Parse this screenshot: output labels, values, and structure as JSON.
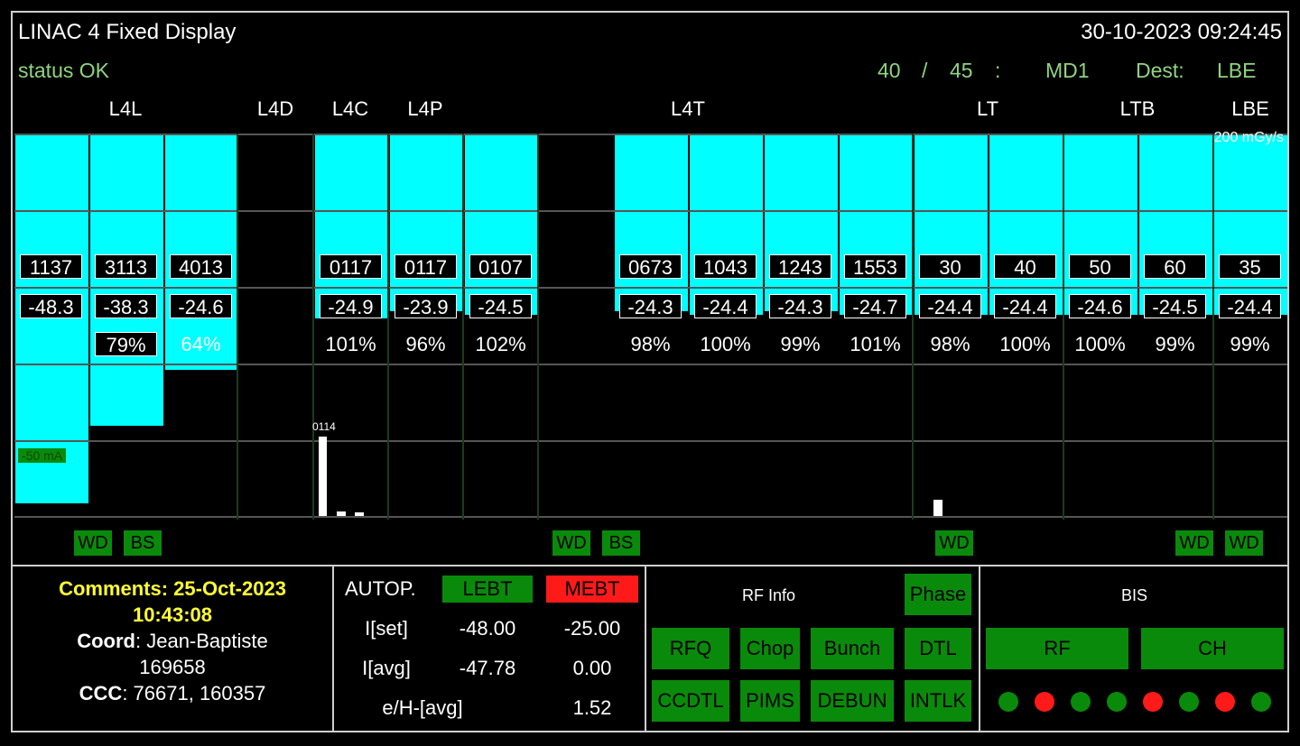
{
  "header": {
    "title": "LINAC 4 Fixed Display",
    "datetime": "30-10-2023 09:24:45",
    "status": "status OK",
    "cycle_current": "40",
    "cycle_sep": "/",
    "cycle_total": "45",
    "colon": ":",
    "user": "MD1",
    "dest_label": "Dest:",
    "dest_value": "LBE"
  },
  "sections": [
    "L4L",
    "L4D",
    "L4C",
    "L4P",
    "L4T",
    "LT",
    "LTB",
    "LBE"
  ],
  "scale_top": "200 mGy/s",
  "scale_left": "-50 mA",
  "spike_label": "0114",
  "columns": [
    {
      "val1": "1137",
      "val2": "-48.3",
      "pct": "",
      "fill": 1.0,
      "pct_boxed": false
    },
    {
      "val1": "3113",
      "val2": "-38.3",
      "pct": "79%",
      "fill": 0.79,
      "pct_boxed": true
    },
    {
      "val1": "4013",
      "val2": "-24.6",
      "pct": "64%",
      "fill": 0.64,
      "pct_boxed": false
    },
    {
      "val1": "",
      "val2": "",
      "pct": "",
      "fill": 0,
      "pct_boxed": false
    },
    {
      "val1": "0117",
      "val2": "-24.9",
      "pct": "101%",
      "fill": 0.5,
      "pct_boxed": false
    },
    {
      "val1": "0117",
      "val2": "-23.9",
      "pct": "96%",
      "fill": 0.48,
      "pct_boxed": false
    },
    {
      "val1": "0107",
      "val2": "-24.5",
      "pct": "102%",
      "fill": 0.49,
      "pct_boxed": false
    },
    {
      "val1": "",
      "val2": "",
      "pct": "",
      "fill": 0,
      "pct_boxed": false
    },
    {
      "val1": "0673",
      "val2": "-24.3",
      "pct": "98%",
      "fill": 0.48,
      "pct_boxed": false
    },
    {
      "val1": "1043",
      "val2": "-24.4",
      "pct": "100%",
      "fill": 0.49,
      "pct_boxed": false
    },
    {
      "val1": "1243",
      "val2": "-24.3",
      "pct": "99%",
      "fill": 0.48,
      "pct_boxed": false
    },
    {
      "val1": "1553",
      "val2": "-24.7",
      "pct": "101%",
      "fill": 0.49,
      "pct_boxed": false
    },
    {
      "val1": "30",
      "val2": "-24.4",
      "pct": "98%",
      "fill": 0.49,
      "pct_boxed": false
    },
    {
      "val1": "40",
      "val2": "-24.4",
      "pct": "100%",
      "fill": 0.49,
      "pct_boxed": false
    },
    {
      "val1": "50",
      "val2": "-24.6",
      "pct": "100%",
      "fill": 0.49,
      "pct_boxed": false
    },
    {
      "val1": "60",
      "val2": "-24.5",
      "pct": "99%",
      "fill": 0.49,
      "pct_boxed": false
    },
    {
      "val1": "35",
      "val2": "-24.4",
      "pct": "99%",
      "fill": 0.49,
      "pct_boxed": false
    }
  ],
  "badges": [
    "WD",
    "BS",
    "WD",
    "BS",
    "WD",
    "WD",
    "WD"
  ],
  "comments": {
    "heading": "Comments: 25-Oct-2023",
    "time": "10:43:08",
    "coord_label": "Coord",
    "coord_value": ": Jean-Baptiste",
    "coord_phone": "169658",
    "ccc_label": "CCC",
    "ccc_value": ": 76671, 160357"
  },
  "autop": {
    "label": "AUTOP.",
    "lebt": "LEBT",
    "mebt": "MEBT",
    "rows": [
      {
        "label": "I[set]",
        "a": "-48.00",
        "b": "-25.00"
      },
      {
        "label": "I[avg]",
        "a": "-47.78",
        "b": "0.00"
      },
      {
        "label": "e/H-[avg]",
        "a": "",
        "b": "1.52"
      }
    ]
  },
  "rf": {
    "title": "RF Info",
    "buttons": [
      "Phase",
      "RFQ",
      "Chop",
      "Bunch",
      "DTL",
      "CCDTL",
      "PIMS",
      "DEBUN",
      "INTLK"
    ]
  },
  "bis": {
    "title": "BIS",
    "buttons": [
      "RF",
      "CH"
    ],
    "dots": [
      "green",
      "red",
      "green",
      "green",
      "red",
      "green",
      "red",
      "green"
    ]
  },
  "colors": {
    "cyan": "#00ffff",
    "green": "#0a8a0a",
    "red": "#ff1a1a",
    "yellow": "#ffff33",
    "status": "#8fd47f"
  }
}
